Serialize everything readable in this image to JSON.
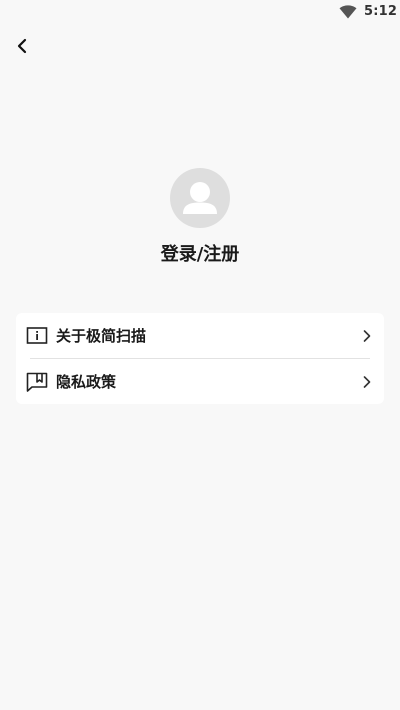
{
  "status_bar": {
    "time": "5:12",
    "wifi_icon": "wifi-icon"
  },
  "nav": {
    "back_icon": "chevron-left-icon"
  },
  "profile": {
    "avatar_icon": "user-avatar-icon",
    "login_label": "登录/注册"
  },
  "menu": {
    "items": [
      {
        "label": "关于极简扫描",
        "icon": "info-icon",
        "chevron": "chevron-right-icon"
      },
      {
        "label": "隐私政策",
        "icon": "privacy-flag-icon",
        "chevron": "chevron-right-icon"
      }
    ]
  },
  "colors": {
    "background": "#f8f8f8",
    "card": "#ffffff",
    "avatar_bg": "#dedede",
    "avatar_fg": "#ffffff",
    "text": "#1a1a1a",
    "divider": "#e2e2e2"
  }
}
